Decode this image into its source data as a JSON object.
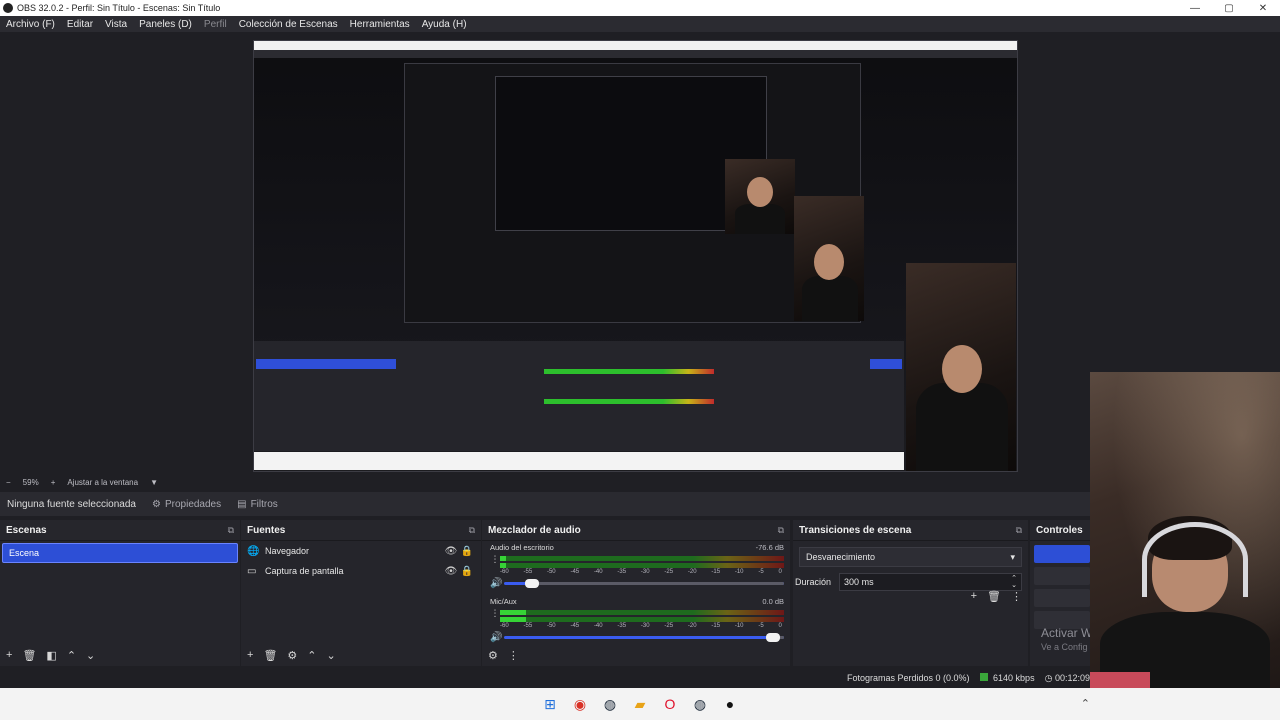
{
  "window": {
    "title": "OBS 32.0.2 - Perfil: Sin Título - Escenas: Sin Título",
    "controls": {
      "minimize": "—",
      "maximize": "▢",
      "close": "✕"
    }
  },
  "menubar": {
    "items": [
      "Archivo (F)",
      "Editar",
      "Vista",
      "Paneles (D)",
      "Perfil",
      "Colección de Escenas",
      "Herramientas",
      "Ayuda (H)"
    ]
  },
  "scale_row": {
    "scale": "59%",
    "fit": "Ajustar a la ventana"
  },
  "source_toolbar": {
    "no_source": "Ninguna fuente seleccionada",
    "properties": "Propiedades",
    "filters": "Filtros"
  },
  "scenes": {
    "title": "Escenas",
    "items": [
      "Escena"
    ]
  },
  "sources": {
    "title": "Fuentes",
    "items": [
      {
        "name": "Navegador",
        "icon": "browser-icon"
      },
      {
        "name": "Captura de pantalla",
        "icon": "monitor-icon"
      }
    ]
  },
  "mixer": {
    "title": "Mezclador de audio",
    "tracks": [
      {
        "name": "Audio del escritorio",
        "db": "-76.6 dB",
        "level": 0.02,
        "volume": 0.1
      },
      {
        "name": "Mic/Aux",
        "db": "0.0 dB",
        "level": 0.09,
        "volume": 0.96
      }
    ],
    "scale": [
      "-60",
      "-55",
      "-50",
      "-45",
      "-40",
      "-35",
      "-30",
      "-25",
      "-20",
      "-15",
      "-10",
      "-5",
      "0"
    ]
  },
  "transitions": {
    "title": "Transiciones de escena",
    "selected": "Desvanecimiento",
    "duration_label": "Duración",
    "duration_value": "300",
    "duration_unit": "ms"
  },
  "controls": {
    "title": "Controles"
  },
  "watermark": {
    "line1": "Activar W",
    "line2": "Ve a Config"
  },
  "statusbar": {
    "dropped": "Fotogramas Perdidos 0 (0.0%)",
    "bitrate": "6140 kbps",
    "time": "00:12:09"
  },
  "colors": {
    "accent": "#2d4fd6",
    "bg": "#1f1f24",
    "dock": "#25252b",
    "meter_green": "#36d336",
    "meter_yellow": "#c7b418",
    "meter_red": "#c12b2b"
  }
}
